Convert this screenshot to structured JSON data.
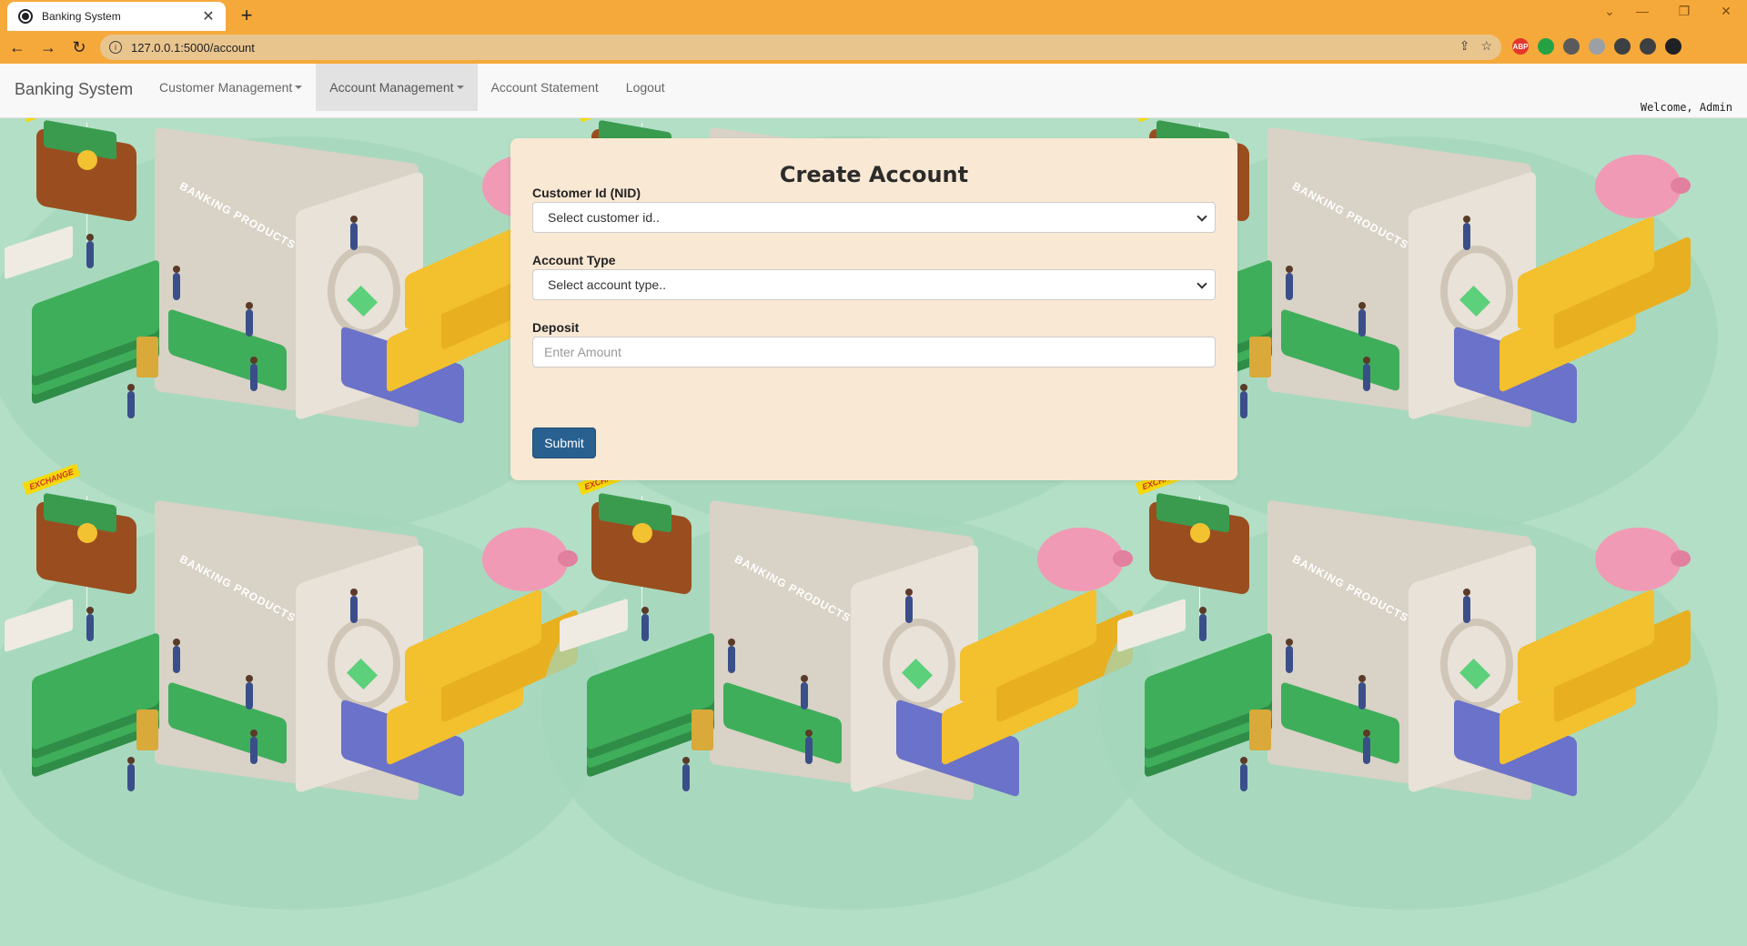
{
  "browser": {
    "tab_title": "Banking System",
    "tab_close": "✕",
    "new_tab": "+",
    "url": "127.0.0.1:5000/account",
    "buttons": {
      "back": "←",
      "forward": "→",
      "reload": "↻"
    },
    "window": {
      "minimize": "—",
      "restore": "❐",
      "close": "✕",
      "dropdown": "⌄"
    },
    "extensions": [
      {
        "name": "adblock-icon",
        "label": "ABP",
        "color": "#e5352b"
      },
      {
        "name": "whatsapp-icon",
        "label": "",
        "color": "#25a244"
      },
      {
        "name": "camera-icon",
        "label": "",
        "color": "#5a5a5a"
      },
      {
        "name": "shield-icon",
        "label": "",
        "color": "#9aa0a6"
      },
      {
        "name": "puzzle-icon",
        "label": "",
        "color": "#3c4043"
      },
      {
        "name": "sidepanel-icon",
        "label": "",
        "color": "#3c4043"
      },
      {
        "name": "profile-icon",
        "label": "",
        "color": "#202124"
      }
    ]
  },
  "navbar": {
    "brand": "Banking System",
    "items": [
      {
        "label": "Customer Management",
        "dropdown": true,
        "active": false
      },
      {
        "label": "Account Management",
        "dropdown": true,
        "active": true
      },
      {
        "label": "Account Statement",
        "dropdown": false,
        "active": false
      },
      {
        "label": "Logout",
        "dropdown": false,
        "active": false
      }
    ],
    "welcome": "Welcome, Admin"
  },
  "background": {
    "tag_text": "EXCHANGE",
    "safe_text": "BANKING PRODUCTS"
  },
  "form": {
    "title": "Create Account",
    "customer_id_label": "Customer Id (NID)",
    "customer_id_value": "Select customer id..",
    "account_type_label": "Account Type",
    "account_type_value": "Select account type..",
    "deposit_label": "Deposit",
    "deposit_placeholder": "Enter Amount",
    "submit_label": "Submit"
  },
  "colors": {
    "chrome": "#f6a93b",
    "background": "#b3dfc6",
    "card": "#f9e8d3",
    "submit": "#286090"
  }
}
